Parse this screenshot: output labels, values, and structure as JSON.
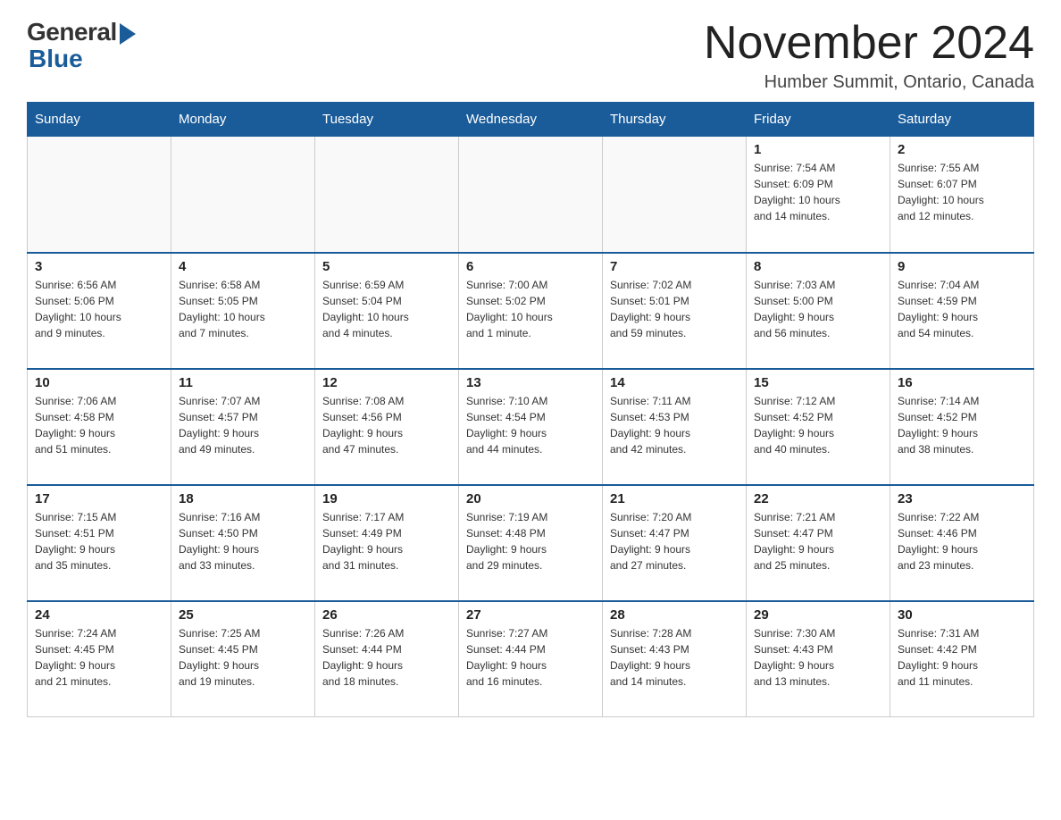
{
  "logo": {
    "general": "General",
    "blue": "Blue"
  },
  "title": {
    "month": "November 2024",
    "location": "Humber Summit, Ontario, Canada"
  },
  "weekdays": [
    "Sunday",
    "Monday",
    "Tuesday",
    "Wednesday",
    "Thursday",
    "Friday",
    "Saturday"
  ],
  "weeks": [
    [
      {
        "day": "",
        "info": ""
      },
      {
        "day": "",
        "info": ""
      },
      {
        "day": "",
        "info": ""
      },
      {
        "day": "",
        "info": ""
      },
      {
        "day": "",
        "info": ""
      },
      {
        "day": "1",
        "info": "Sunrise: 7:54 AM\nSunset: 6:09 PM\nDaylight: 10 hours\nand 14 minutes."
      },
      {
        "day": "2",
        "info": "Sunrise: 7:55 AM\nSunset: 6:07 PM\nDaylight: 10 hours\nand 12 minutes."
      }
    ],
    [
      {
        "day": "3",
        "info": "Sunrise: 6:56 AM\nSunset: 5:06 PM\nDaylight: 10 hours\nand 9 minutes."
      },
      {
        "day": "4",
        "info": "Sunrise: 6:58 AM\nSunset: 5:05 PM\nDaylight: 10 hours\nand 7 minutes."
      },
      {
        "day": "5",
        "info": "Sunrise: 6:59 AM\nSunset: 5:04 PM\nDaylight: 10 hours\nand 4 minutes."
      },
      {
        "day": "6",
        "info": "Sunrise: 7:00 AM\nSunset: 5:02 PM\nDaylight: 10 hours\nand 1 minute."
      },
      {
        "day": "7",
        "info": "Sunrise: 7:02 AM\nSunset: 5:01 PM\nDaylight: 9 hours\nand 59 minutes."
      },
      {
        "day": "8",
        "info": "Sunrise: 7:03 AM\nSunset: 5:00 PM\nDaylight: 9 hours\nand 56 minutes."
      },
      {
        "day": "9",
        "info": "Sunrise: 7:04 AM\nSunset: 4:59 PM\nDaylight: 9 hours\nand 54 minutes."
      }
    ],
    [
      {
        "day": "10",
        "info": "Sunrise: 7:06 AM\nSunset: 4:58 PM\nDaylight: 9 hours\nand 51 minutes."
      },
      {
        "day": "11",
        "info": "Sunrise: 7:07 AM\nSunset: 4:57 PM\nDaylight: 9 hours\nand 49 minutes."
      },
      {
        "day": "12",
        "info": "Sunrise: 7:08 AM\nSunset: 4:56 PM\nDaylight: 9 hours\nand 47 minutes."
      },
      {
        "day": "13",
        "info": "Sunrise: 7:10 AM\nSunset: 4:54 PM\nDaylight: 9 hours\nand 44 minutes."
      },
      {
        "day": "14",
        "info": "Sunrise: 7:11 AM\nSunset: 4:53 PM\nDaylight: 9 hours\nand 42 minutes."
      },
      {
        "day": "15",
        "info": "Sunrise: 7:12 AM\nSunset: 4:52 PM\nDaylight: 9 hours\nand 40 minutes."
      },
      {
        "day": "16",
        "info": "Sunrise: 7:14 AM\nSunset: 4:52 PM\nDaylight: 9 hours\nand 38 minutes."
      }
    ],
    [
      {
        "day": "17",
        "info": "Sunrise: 7:15 AM\nSunset: 4:51 PM\nDaylight: 9 hours\nand 35 minutes."
      },
      {
        "day": "18",
        "info": "Sunrise: 7:16 AM\nSunset: 4:50 PM\nDaylight: 9 hours\nand 33 minutes."
      },
      {
        "day": "19",
        "info": "Sunrise: 7:17 AM\nSunset: 4:49 PM\nDaylight: 9 hours\nand 31 minutes."
      },
      {
        "day": "20",
        "info": "Sunrise: 7:19 AM\nSunset: 4:48 PM\nDaylight: 9 hours\nand 29 minutes."
      },
      {
        "day": "21",
        "info": "Sunrise: 7:20 AM\nSunset: 4:47 PM\nDaylight: 9 hours\nand 27 minutes."
      },
      {
        "day": "22",
        "info": "Sunrise: 7:21 AM\nSunset: 4:47 PM\nDaylight: 9 hours\nand 25 minutes."
      },
      {
        "day": "23",
        "info": "Sunrise: 7:22 AM\nSunset: 4:46 PM\nDaylight: 9 hours\nand 23 minutes."
      }
    ],
    [
      {
        "day": "24",
        "info": "Sunrise: 7:24 AM\nSunset: 4:45 PM\nDaylight: 9 hours\nand 21 minutes."
      },
      {
        "day": "25",
        "info": "Sunrise: 7:25 AM\nSunset: 4:45 PM\nDaylight: 9 hours\nand 19 minutes."
      },
      {
        "day": "26",
        "info": "Sunrise: 7:26 AM\nSunset: 4:44 PM\nDaylight: 9 hours\nand 18 minutes."
      },
      {
        "day": "27",
        "info": "Sunrise: 7:27 AM\nSunset: 4:44 PM\nDaylight: 9 hours\nand 16 minutes."
      },
      {
        "day": "28",
        "info": "Sunrise: 7:28 AM\nSunset: 4:43 PM\nDaylight: 9 hours\nand 14 minutes."
      },
      {
        "day": "29",
        "info": "Sunrise: 7:30 AM\nSunset: 4:43 PM\nDaylight: 9 hours\nand 13 minutes."
      },
      {
        "day": "30",
        "info": "Sunrise: 7:31 AM\nSunset: 4:42 PM\nDaylight: 9 hours\nand 11 minutes."
      }
    ]
  ]
}
